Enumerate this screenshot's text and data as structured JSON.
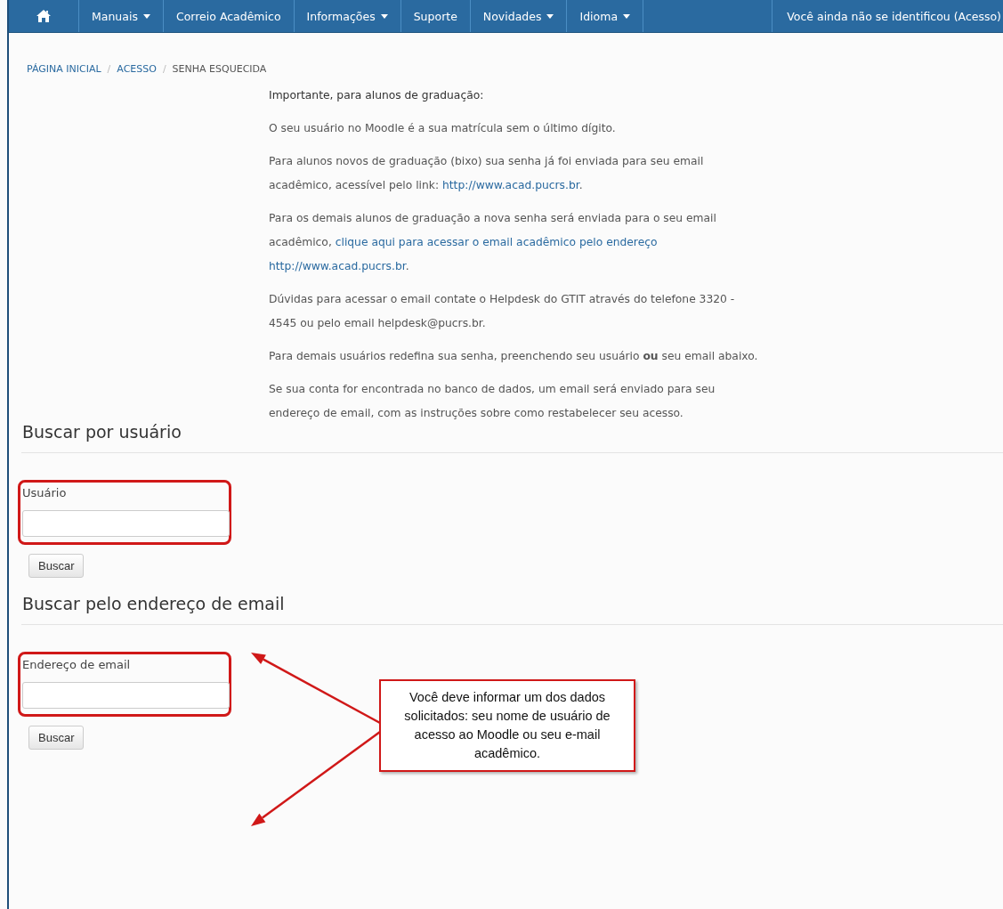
{
  "navbar": {
    "items": [
      {
        "kind": "home"
      },
      {
        "kind": "menu",
        "label": "Manuais",
        "dropdown": true
      },
      {
        "kind": "menu",
        "label": "Correio Acadêmico",
        "dropdown": false
      },
      {
        "kind": "menu",
        "label": "Informações",
        "dropdown": true
      },
      {
        "kind": "menu",
        "label": "Suporte",
        "dropdown": false
      },
      {
        "kind": "menu",
        "label": "Novidades",
        "dropdown": true
      },
      {
        "kind": "menu",
        "label": "Idioma",
        "dropdown": true
      }
    ],
    "login_status": "Você ainda não se identificou (Acesso)"
  },
  "breadcrumb": [
    "PÁGINA INICIAL",
    "ACESSO",
    "SENHA ESQUECIDA"
  ],
  "breadcrumb_separator": "/",
  "intro": [
    [
      {
        "kind": "strong",
        "text": "Importante, para alunos de graduação:"
      }
    ],
    [
      {
        "kind": "text",
        "text": "O seu usuário no Moodle é a sua matrícula sem o último dígito."
      }
    ],
    [
      {
        "kind": "text",
        "text": "Para alunos novos de graduação (bixo) sua senha já foi enviada para seu email acadêmico, acessível pelo link:"
      },
      {
        "kind": "link",
        "text": "http://www.acad.pucrs.br"
      },
      {
        "kind": "text",
        "text": "."
      }
    ],
    [
      {
        "kind": "text",
        "text": "Para os demais alunos de graduação a nova senha será enviada para o seu email acadêmico,"
      },
      {
        "kind": "link",
        "text": "clique aqui para acessar o email acadêmico pelo endereço"
      },
      {
        "kind": "link",
        "text": "http://www.acad.pucrs.br"
      },
      {
        "kind": "text",
        "text": "."
      }
    ],
    [
      {
        "kind": "text",
        "text": "Dúvidas para acessar o email contate o Helpdesk do GTIT através do telefone 3320 - 4545 ou pelo email helpdesk@pucrs.br."
      }
    ],
    [
      {
        "kind": "text",
        "text": "Para demais usuários redefina sua senha, preenchendo seu usuário **ou** seu email abaixo."
      }
    ],
    [
      {
        "kind": "text",
        "text": "Se sua conta for encontrada no banco de dados, um email será enviado para seu endereço de email, com as instruções sobre como restabelecer seu acesso."
      }
    ]
  ],
  "sections": [
    {
      "heading": "Buscar por usuário",
      "field_label": "Usuário",
      "highlighted": true,
      "button": "Buscar"
    },
    {
      "heading": "Buscar pelo endereço de email",
      "field_label": "Endereço de email",
      "highlighted": true,
      "button": "Buscar"
    }
  ],
  "callout": {
    "text": "Você deve informar um dos dados solicitados: seu nome de usuário de acesso ao Moodle ou seu e-mail acadêmico."
  }
}
